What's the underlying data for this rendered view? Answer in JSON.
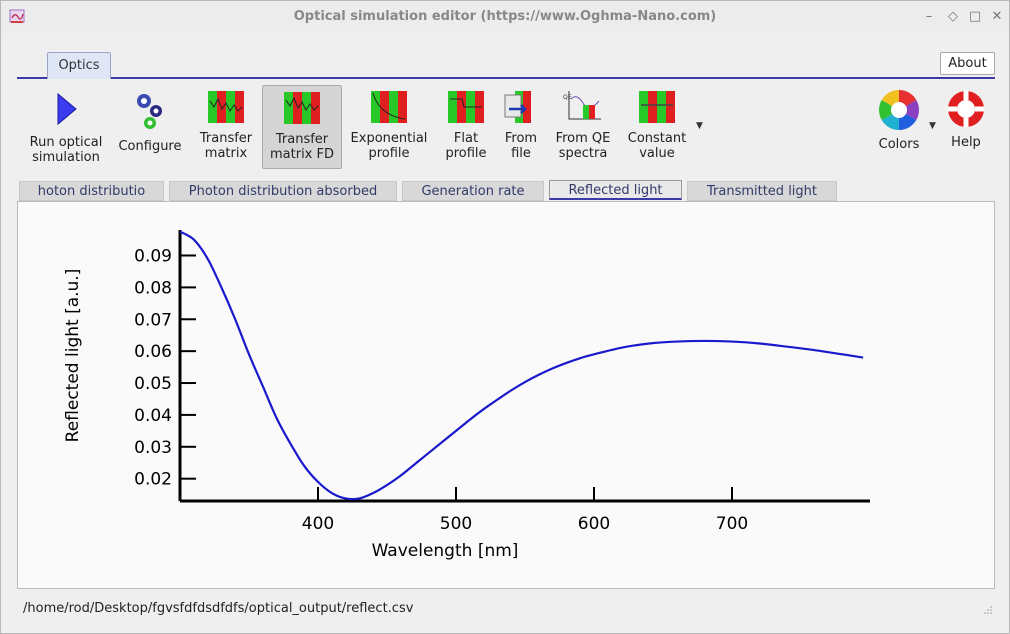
{
  "window": {
    "title": "Optical simulation editor (https://www.Oghma-Nano.com)",
    "controls": [
      "–",
      "◇",
      "□",
      "✕"
    ]
  },
  "main_tab": {
    "label": "Optics"
  },
  "about_button": {
    "label": "About"
  },
  "toolbar": {
    "items": [
      {
        "label": "Run optical\nsimulation",
        "icon": "play-icon"
      },
      {
        "label": "Configure",
        "icon": "gears-icon"
      },
      {
        "label": "Transfer\nmatrix",
        "icon": "transfer-matrix-icon"
      },
      {
        "label": "Transfer\nmatrix FD",
        "icon": "transfer-matrix-fd-icon"
      },
      {
        "label": "Exponential\nprofile",
        "icon": "exponential-profile-icon"
      },
      {
        "label": "Flat\nprofile",
        "icon": "flat-profile-icon"
      },
      {
        "label": "From\nfile",
        "icon": "from-file-icon"
      },
      {
        "label": "From QE\nspectra",
        "icon": "qe-spectra-icon"
      },
      {
        "label": "Constant\nvalue",
        "icon": "constant-value-icon"
      },
      {
        "label": "Colors",
        "icon": "color-wheel-icon"
      },
      {
        "label": "Help",
        "icon": "lifebuoy-icon"
      }
    ]
  },
  "subtabs": [
    {
      "label": "hoton distributio"
    },
    {
      "label": "Photon distribution absorbed"
    },
    {
      "label": "Generation rate"
    },
    {
      "label": "Reflected light"
    },
    {
      "label": "Transmitted light"
    }
  ],
  "status": {
    "path": "/home/rod/Desktop/fgvsfdfdsdfdfs/optical_output/reflect.csv"
  },
  "colors": {
    "accent": "#3a3aa8",
    "line": "#1a1acc",
    "axis": "#000000"
  },
  "chart_data": {
    "type": "line",
    "xlabel": "Wavelength [nm]",
    "ylabel": "Reflected light [a.u.]",
    "xlim": [
      300,
      800
    ],
    "ylim": [
      0.013,
      0.098
    ],
    "xticks": [
      400,
      500,
      600,
      700
    ],
    "yticks": [
      0.02,
      0.03,
      0.04,
      0.05,
      0.06,
      0.07,
      0.08,
      0.09
    ],
    "ytick_labels": [
      "0.02",
      "0.03",
      "0.04",
      "0.05",
      "0.06",
      "0.07",
      "0.08",
      "0.09"
    ],
    "xtick_labels": [
      "400",
      "500",
      "600",
      "700"
    ],
    "series": [
      {
        "x": [
          300,
          310,
          320,
          330,
          340,
          350,
          360,
          370,
          380,
          390,
          400,
          410,
          420,
          430,
          440,
          450,
          460,
          470,
          480,
          490,
          500,
          510,
          520,
          530,
          540,
          550,
          560,
          570,
          580,
          590,
          600,
          620,
          640,
          660,
          680,
          700,
          720,
          740,
          760,
          780,
          795
        ],
        "y": [
          0.0975,
          0.095,
          0.089,
          0.08,
          0.07,
          0.059,
          0.049,
          0.039,
          0.031,
          0.024,
          0.019,
          0.0155,
          0.0138,
          0.0138,
          0.0155,
          0.018,
          0.021,
          0.0245,
          0.028,
          0.0315,
          0.035,
          0.0385,
          0.0418,
          0.0448,
          0.0477,
          0.0503,
          0.0526,
          0.0546,
          0.0563,
          0.0578,
          0.059,
          0.0611,
          0.0624,
          0.063,
          0.0632,
          0.063,
          0.0624,
          0.0614,
          0.0603,
          0.059,
          0.058
        ]
      }
    ],
    "grid": false
  }
}
